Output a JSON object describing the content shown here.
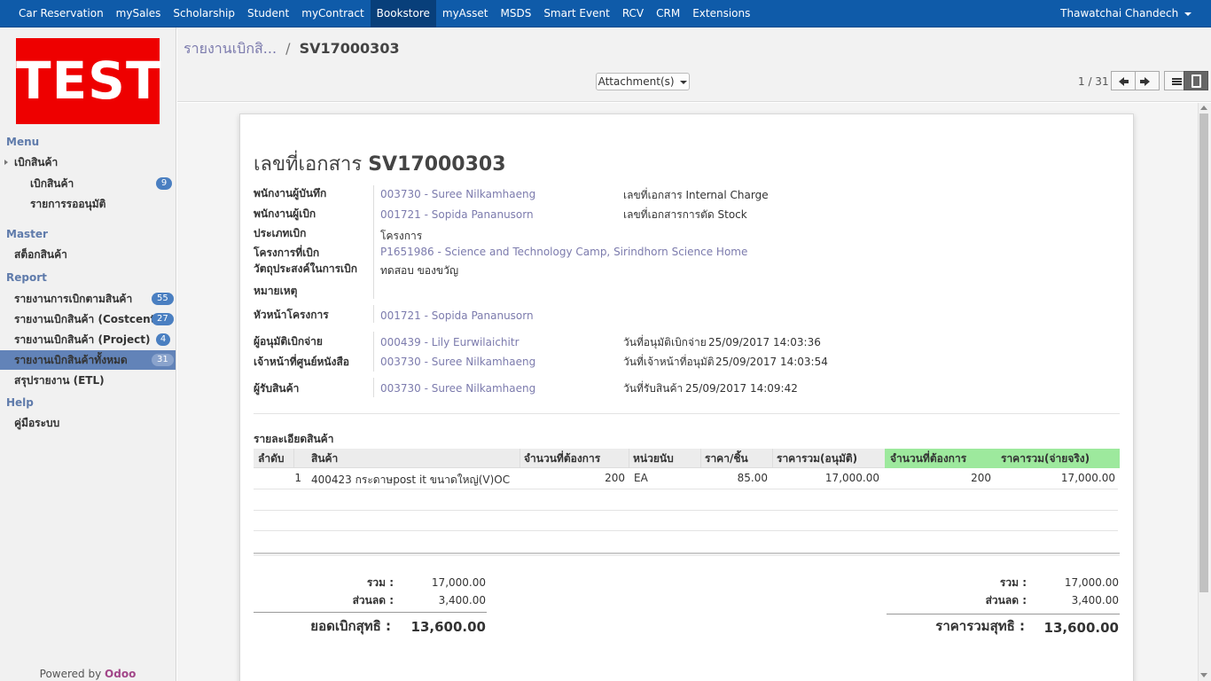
{
  "topbar": {
    "menu": [
      "Car Reservation",
      "mySales",
      "Scholarship",
      "Student",
      "myContract",
      "Bookstore",
      "myAsset",
      "MSDS",
      "Smart Event",
      "RCV",
      "CRM",
      "Extensions"
    ],
    "active": "Bookstore",
    "user": "Thawatchai Chandech"
  },
  "sidebar": {
    "logo_text": "TEST",
    "menu_header": "Menu",
    "menu_parent": "เบิกสินค้า",
    "menu_items": [
      {
        "label": "เบิกสินค้า",
        "count": "9"
      },
      {
        "label": "รายการรออนุมัติ",
        "count": ""
      }
    ],
    "master_header": "Master",
    "master_items": [
      {
        "label": "สต็อกสินค้า"
      }
    ],
    "report_header": "Report",
    "report_items": [
      {
        "label": "รายงานการเบิกตามสินค้า",
        "count": "55"
      },
      {
        "label": "รายงานเบิกสินค้า (Costcenter)",
        "count": "27"
      },
      {
        "label": "รายงานเบิกสินค้า (Project)",
        "count": "4"
      },
      {
        "label": "รายงานเบิกสินค้าทั้งหมด",
        "count": "31"
      },
      {
        "label": "สรุปรายงาน (ETL)",
        "count": ""
      }
    ],
    "help_header": "Help",
    "help_items": [
      {
        "label": "คู่มือระบบ"
      }
    ],
    "powered_prefix": "Powered by",
    "powered_brand": "Odoo"
  },
  "control_panel": {
    "breadcrumb_parent": "รายงานเบิกสิ...",
    "breadcrumb_sep": "/",
    "breadcrumb_current": "SV17000303",
    "attachment_label": "Attachment(s)",
    "pager": "1 / 31"
  },
  "form": {
    "title_label": "เลขที่เอกสาร",
    "title_value": "SV17000303",
    "fields": {
      "recorder_label": "พนักงานผู้บันทึก",
      "recorder": "003730 - Suree Nilkamhaeng",
      "requester_label": "พนักงานผู้เบิก",
      "requester": "001721 - Sopida Pananusorn",
      "type_label": "ประเภทเบิก",
      "type": "โครงการ",
      "project_label": "โครงการที่เบิก",
      "project": "P1651986 - Science and Technology Camp, Sirindhorn Science Home",
      "purpose_label": "วัตถุประสงค์ในการเบิก",
      "purpose": "ทดสอบ ของขวัญ",
      "note_label": "หมายเหตุ",
      "head_label": "หัวหน้าโครงการ",
      "head": "001721 - Sopida Pananusorn",
      "approver_label": "ผู้อนุมัติเบิกจ่าย",
      "approver": "000439 - Lily Eurwilaichitr",
      "officer_label": "เจ้าหน้าที่ศูนย์หนังสือ",
      "officer": "003730 - Suree Nilkamhaeng",
      "receiver_label": "ผู้รับสินค้า",
      "receiver": "003730 - Suree Nilkamhaeng",
      "internal_charge_label": "เลขที่เอกสาร Internal Charge",
      "stock_doc_label": "เลขที่เอกสารการตัด Stock",
      "approve_date_label": "วันที่อนุมัติเบิกจ่าย",
      "approve_date": "25/09/2017 14:03:36",
      "officer_date_label": "วันที่เจ้าหน้าที่อนุมัติ",
      "officer_date": "25/09/2017 14:03:54",
      "receive_date_label": "วันที่รับสินค้า",
      "receive_date": "25/09/2017 14:09:42"
    },
    "lines_title": "รายละเอียดสินค้า",
    "columns": [
      "ลำดับ",
      "สินค้า",
      "จำนวนที่ต้องการ",
      "หน่วยนับ",
      "ราคา/ชิ้น",
      "ราคารวม(อนุมัติ)",
      "จำนวนที่ต้องการ",
      "ราคารวม(จ่ายจริง)"
    ],
    "row": {
      "seq": "1",
      "product": "400423 กระดาษpost it ขนาดใหญ่(V)OC",
      "qty": "200",
      "uom": "EA",
      "price": "85.00",
      "total_approved": "17,000.00",
      "qty_actual": "200",
      "total_actual": "17,000.00"
    },
    "summary_left": {
      "sum_label": "รวม :",
      "sum": "17,000.00",
      "discount_label": "ส่วนลด :",
      "discount": "3,400.00",
      "net_label": "ยอดเบิกสุทธิ :",
      "net": "13,600.00"
    },
    "summary_right": {
      "sum_label": "รวม :",
      "sum": "17,000.00",
      "discount_label": "ส่วนลด :",
      "discount": "3,400.00",
      "net_label": "ราคารวมสุทธิ :",
      "net": "13,600.00"
    }
  },
  "colors": {
    "topbar": "#0f5ba9",
    "link": "#7c7bad",
    "sidebar_active": "#6283b8",
    "badge": "#4a7fc1",
    "logo_bg": "#ee0000",
    "green_header": "#9de99d",
    "odoo": "#a24689"
  }
}
